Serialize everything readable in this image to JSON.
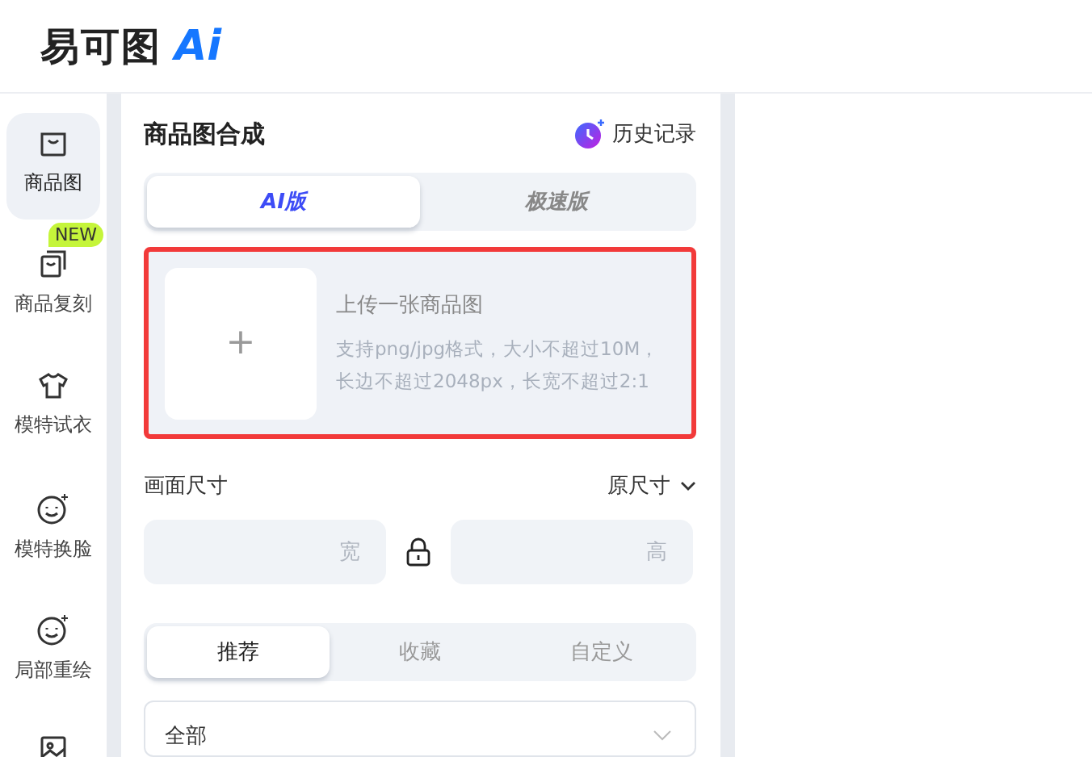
{
  "logo": {
    "text": "易可图",
    "ai": "Ai"
  },
  "sidebar": {
    "items": [
      {
        "label": "商品图",
        "selected": true
      },
      {
        "label": "商品复刻",
        "selected": false,
        "badge": "NEW"
      },
      {
        "label": "模特试衣",
        "selected": false
      },
      {
        "label": "模特换脸",
        "selected": false
      },
      {
        "label": "局部重绘",
        "selected": false
      },
      {
        "selected": false
      }
    ]
  },
  "panel": {
    "title": "商品图合成",
    "history": "历史记录",
    "modes": [
      {
        "label": "AI版",
        "selected": true
      },
      {
        "label": "极速版",
        "selected": false
      }
    ],
    "upload": {
      "plus": "+",
      "title": "上传一张商品图",
      "hint": "支持png/jpg格式，大小不超过10M，长边不超过2048px，长宽不超过2:1"
    },
    "size": {
      "label": "画面尺寸",
      "value": "原尺寸",
      "width_placeholder": "宽",
      "height_placeholder": "高"
    },
    "tabs": [
      {
        "label": "推荐",
        "selected": true
      },
      {
        "label": "收藏",
        "selected": false
      },
      {
        "label": "自定义",
        "selected": false
      }
    ],
    "category": {
      "value": "全部"
    }
  }
}
